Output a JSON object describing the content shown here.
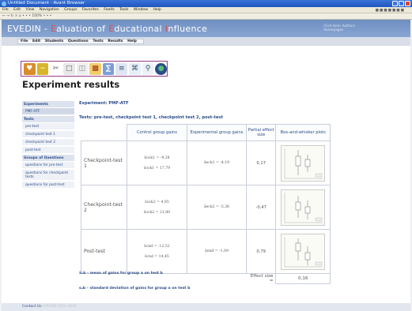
{
  "browser": {
    "title": "Untitled Document - Avant Browser",
    "menu": [
      "File",
      "Edit",
      "View",
      "Navigation",
      "Groups",
      "Favorites",
      "Feeds",
      "Tools",
      "Window",
      "Help"
    ],
    "address": "← → ↻ × ⌂ • • • 100% • • •"
  },
  "app": {
    "title_parts": [
      "EVEDIN - ",
      "E",
      "aluation of ",
      "E",
      "ducational ",
      "I",
      "nfluence"
    ],
    "user_line1": "Click here: Authors",
    "user_line2": "Homepages"
  },
  "nav": [
    "File",
    "Edit",
    "Students",
    "Questions",
    "Tests",
    "Results",
    "Help"
  ],
  "page_title": "Experiment results",
  "sidebar": [
    {
      "label": "Experiments",
      "type": "header"
    },
    {
      "label": "PMF-ATF",
      "type": "item",
      "selected": true
    },
    {
      "label": "Tests",
      "type": "header"
    },
    {
      "label": "pre-test",
      "type": "item"
    },
    {
      "label": "checkpoint test 1",
      "type": "item"
    },
    {
      "label": "checkpoint test 2",
      "type": "item"
    },
    {
      "label": "post-test",
      "type": "item"
    },
    {
      "label": "Groups of Questions",
      "type": "header"
    },
    {
      "label": "questions for pre-test",
      "type": "item"
    },
    {
      "label": "questions for checkpoint tests",
      "type": "item"
    },
    {
      "label": "questions for post-test",
      "type": "item"
    }
  ],
  "main": {
    "experiment_label": "Experiment: PMF-ATF",
    "tests_label": "Tests: pre-test, checkpoint test 1, checkpoint test 2, post-test",
    "headers": [
      "",
      "Control group gains",
      "Experimental group gains",
      "Partial effect size",
      "Box-and-whisker plots"
    ],
    "rows": [
      {
        "name": "Checkpoint-test 1",
        "control": [
          "x̄ock1 = -9,28",
          "s̅ock1 = 17,79"
        ],
        "experimental": "x̄eck1 = -4,19",
        "effect": "0,17"
      },
      {
        "name": "Checkpoint-test 2",
        "control": [
          "x̄ock2 = 4,95",
          "s̅ock2 = 21,80"
        ],
        "experimental": "x̄eck2 = -5,36",
        "effect": "-0,47"
      },
      {
        "name": "Post-test",
        "control": [
          "x̄cnd = -12,52",
          "s̅cnd = 14,45"
        ],
        "experimental": "x̄end = -1,09",
        "effect": "0,79"
      }
    ],
    "effect_size_label": "Effect size =",
    "effect_size_value": "0,16"
  },
  "legend": {
    "line1": "x̄ₐb – mean of gains for group a on test b",
    "line2": "sₐb – standard deviation of gains for group a on test b"
  },
  "footer": {
    "label": "Contact Us",
    "dim": "EVEDIN 2004-2006"
  },
  "colors": {
    "accent": "#2c4d8c",
    "highlight": "#c0282d",
    "header": "#7d9bca",
    "iconbar_border": "#993c8a"
  },
  "icons": [
    "handshake-icon",
    "link-icon",
    "scissors-icon",
    "document-icon",
    "copy-icon",
    "chart-icon",
    "statistics-icon",
    "list-icon",
    "search-stats-icon",
    "zoom-icon",
    "globe-icon"
  ]
}
